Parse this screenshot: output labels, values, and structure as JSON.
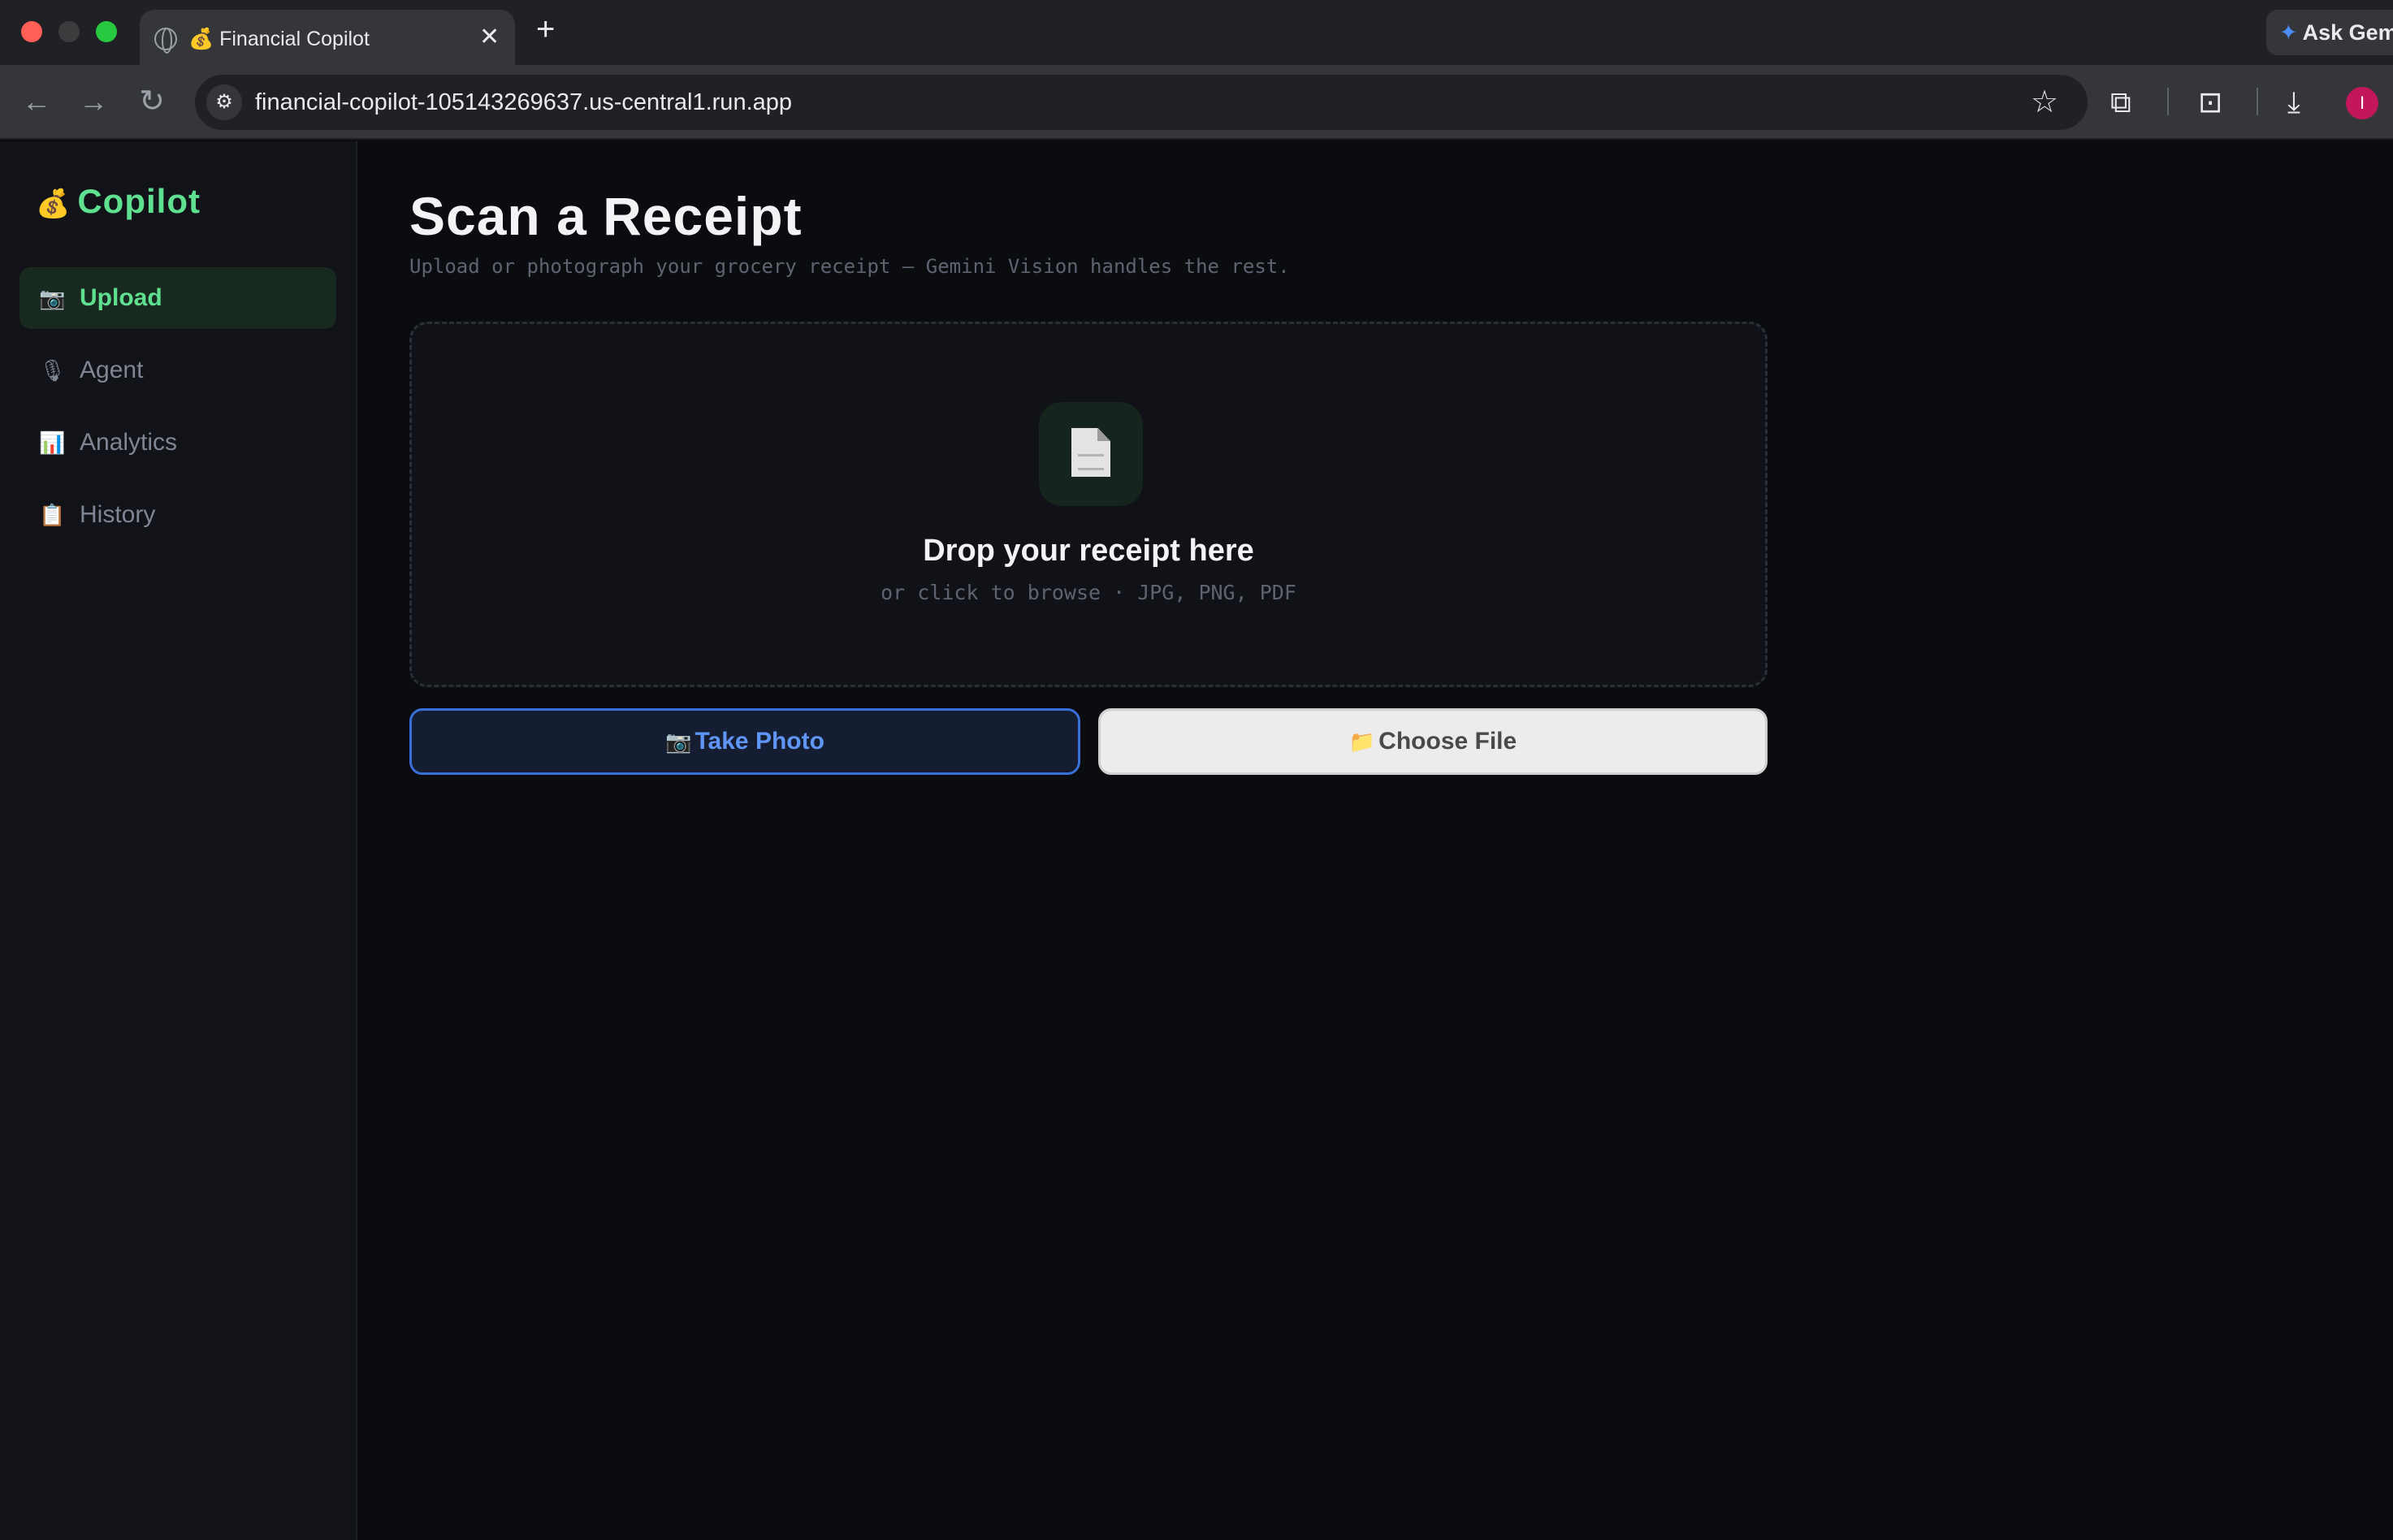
{
  "browser": {
    "tab_title": "Financial Copilot",
    "tab_icon": "💰",
    "close_glyph": "✕",
    "new_tab_glyph": "+",
    "ask_gemini_label": "Ask Gem",
    "url": "financial-copilot-105143269637.us-central1.run.app",
    "avatar_initial": "I"
  },
  "sidebar": {
    "brand_icon": "💰",
    "brand": "Copilot",
    "items": [
      {
        "icon": "📷",
        "label": "Upload",
        "active": true
      },
      {
        "icon": "🎙",
        "label": "Agent",
        "active": false
      },
      {
        "icon": "📊",
        "label": "Analytics",
        "active": false
      },
      {
        "icon": "📋",
        "label": "History",
        "active": false
      }
    ]
  },
  "main": {
    "title": "Scan a Receipt",
    "subtitle": "Upload or photograph your grocery receipt — Gemini Vision handles the rest.",
    "dropzone": {
      "title": "Drop your receipt here",
      "hint": "or click to browse · JPG, PNG, PDF"
    },
    "buttons": {
      "photo_icon": "📷",
      "photo_label": "Take Photo",
      "file_icon": "📁",
      "file_label": "Choose File"
    }
  },
  "colors": {
    "accent_green": "#5ee08f",
    "accent_blue": "#5f95f5",
    "background": "#0b0c10",
    "sidebar_bg": "#111318"
  }
}
